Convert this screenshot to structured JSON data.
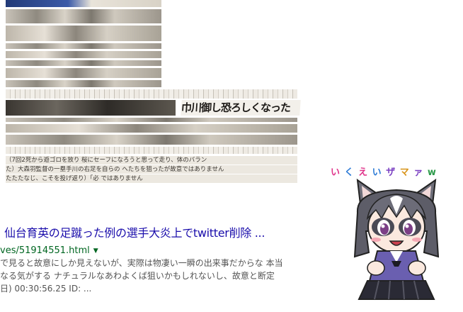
{
  "thumbnail": {
    "headline": "巾川御し恐ろしくなった",
    "caption_1": "（7回2死から遊ゴロを放り 桜にセーフになろうと思って走り、体のバラン",
    "caption_2": "た）大森羽監督の一塁手川の右足を自らの へたちを狙ったが故意ではありません",
    "caption_3": "たたたなじ、こそを投げ返り）「必 ではありません"
  },
  "result": {
    "title": "仙台育英の足蹴った例の選手大炎上でtwitter削除 ...",
    "url": "ves/51914551.html",
    "url_arrow": "▼",
    "snippet_1": "で見ると故意にしか見えないが、実際は物凄い一瞬の出来事だからな 本当",
    "snippet_2": "なる気がする ナチュラルなあわよくば狙いかもしれないし、故意と断定",
    "snippet_3": "日) 00:30:56.25 ID: ..."
  },
  "catchphrase": {
    "chars": [
      "い",
      "く",
      "え",
      "い",
      "ザ",
      "マ",
      "ァ",
      "w"
    ],
    "colors": [
      "#e0338a",
      "#2c7ad6",
      "#e0338a",
      "#2c7ad6",
      "#7a3fc2",
      "#d8941a",
      "#7a3fc2",
      "#2c9a4a"
    ]
  }
}
